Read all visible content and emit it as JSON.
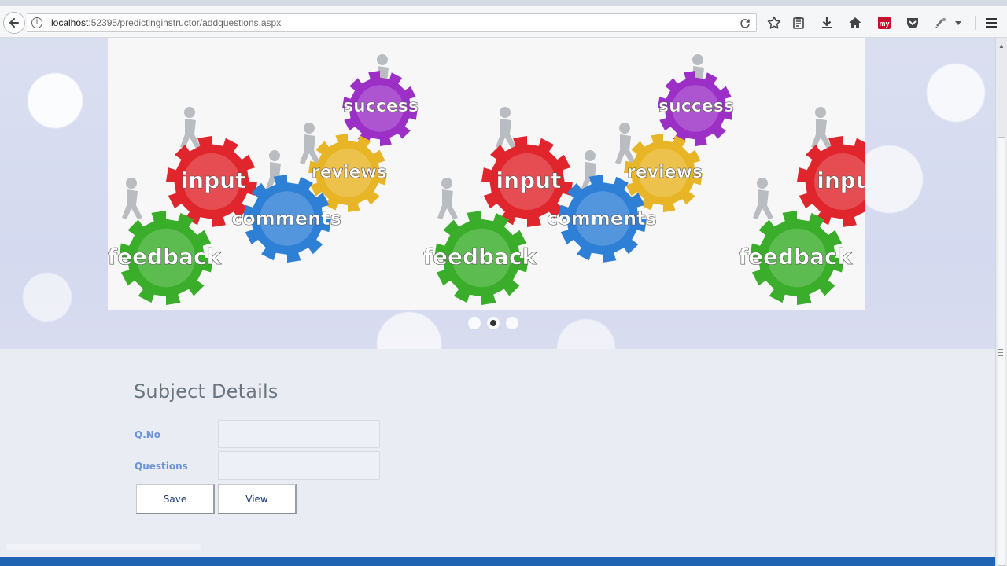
{
  "browser": {
    "url_host": "localhost",
    "url_rest": ":52395/predictinginstructor/addquestions.aspx",
    "my_badge": "my"
  },
  "carousel": {
    "active_slide": 2,
    "slide_count": 3,
    "image_words": [
      "success",
      "reviews",
      "input",
      "comments",
      "feedback",
      "success",
      "reviews",
      "input",
      "comments",
      "feedback",
      "inpu",
      "feedback"
    ]
  },
  "form": {
    "title": "Subject Details",
    "qno_label": "Q.No",
    "qno_value": "",
    "questions_label": "Questions",
    "questions_value": "",
    "save_label": "Save",
    "view_label": "View"
  },
  "colors": {
    "accent": "#1f64b3",
    "label": "#6b93d6",
    "gear_green": "#3aae2a",
    "gear_red": "#e0262c",
    "gear_blue": "#2e7fd6",
    "gear_yellow": "#e8b526",
    "gear_purple": "#9b2fc6"
  }
}
